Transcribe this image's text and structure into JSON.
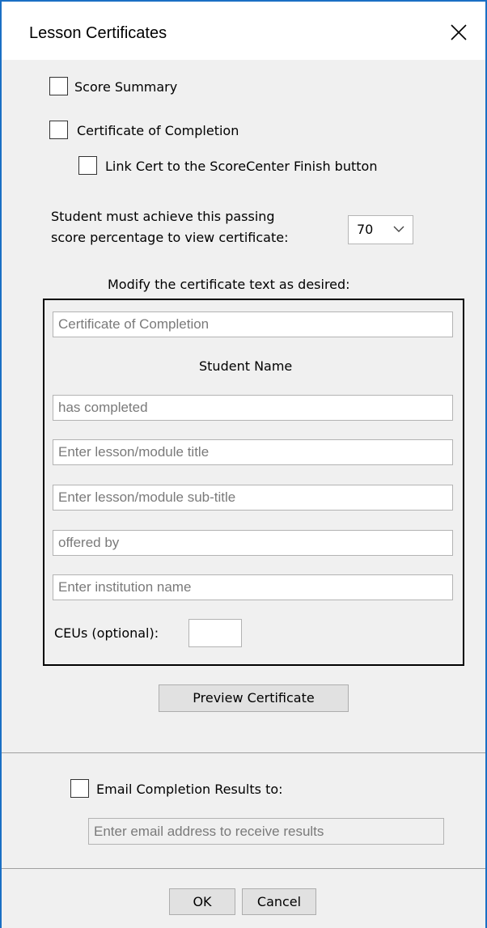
{
  "window": {
    "title": "Lesson Certificates"
  },
  "options": {
    "score_summary": "Score Summary",
    "certificate_of_completion": "Certificate of Completion",
    "link_cert": "Link Cert to the ScoreCenter Finish button"
  },
  "passing": {
    "line1": "Student must achieve this passing",
    "line2": "score percentage to view certificate:",
    "selected_value": "70"
  },
  "certificate": {
    "heading": "Modify the certificate text as desired:",
    "title_placeholder": "Certificate of Completion",
    "student_name": "Student Name",
    "completed_placeholder": "has completed",
    "lesson_title_placeholder": "Enter lesson/module title",
    "lesson_subtitle_placeholder": "Enter lesson/module sub-title",
    "offered_by_placeholder": "offered by",
    "institution_placeholder": "Enter institution name",
    "ceus_label": "CEUs (optional):"
  },
  "preview_button": "Preview Certificate",
  "email": {
    "label": "Email Completion Results to:",
    "placeholder": "Enter email address to receive results"
  },
  "footer": {
    "ok": "OK",
    "cancel": "Cancel"
  },
  "colors": {
    "window_border": "#1a6fc4",
    "dialog_bg": "#f0f0f0",
    "button_bg": "#e1e1e1"
  }
}
